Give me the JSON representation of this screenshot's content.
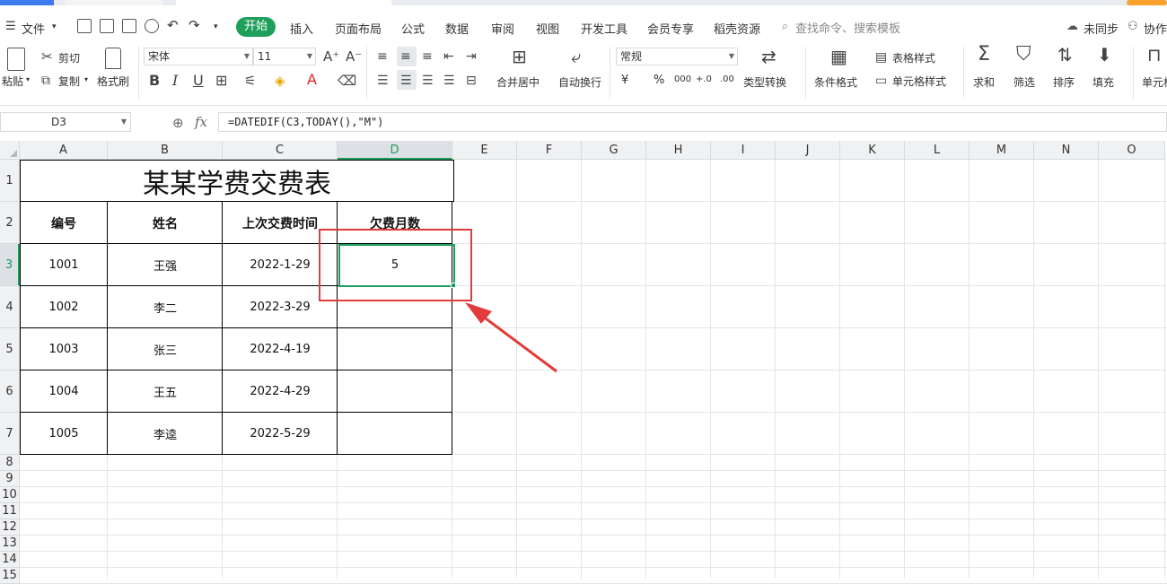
{
  "menubar": {
    "file_label": "文件",
    "start_label": "开始",
    "tabs": [
      "插入",
      "页面布局",
      "公式",
      "数据",
      "审阅",
      "视图",
      "开发工具",
      "会员专享",
      "稻壳资源"
    ],
    "search_placeholder": "查找命令、搜索模板",
    "sync_label": "未同步",
    "collab_label": "协作"
  },
  "ribbon": {
    "paste_label": "粘贴",
    "cut_label": "剪切",
    "copy_label": "复制",
    "format_painter_label": "格式刷",
    "font_name": "宋体",
    "font_size": "11",
    "merge_center_label": "合并居中",
    "wrap_text_label": "自动换行",
    "number_format": "常规",
    "type_convert_label": "类型转换",
    "cond_format_label": "条件格式",
    "table_style_label": "表格样式",
    "cell_style_label": "单元格样式",
    "sum_label": "求和",
    "filter_label": "筛选",
    "sort_label": "排序",
    "fill_label": "填充",
    "cell_label": "单元格",
    "currency_symbol": "¥",
    "percent_symbol": "%",
    "thousands_symbol": "000",
    "dec_inc_symbol": "+.0",
    "dec_dec_symbol": ".00"
  },
  "formula_bar": {
    "name_box": "D3",
    "fx_label": "fx",
    "formula": "=DATEDIF(C3,TODAY(),\"M\")"
  },
  "sheet": {
    "columns": [
      "A",
      "B",
      "C",
      "D",
      "E",
      "F",
      "G",
      "H",
      "I",
      "J",
      "K",
      "L",
      "M",
      "N",
      "O"
    ],
    "rows": [
      "1",
      "2",
      "3",
      "4",
      "5",
      "6",
      "7",
      "8",
      "9",
      "10",
      "11",
      "12",
      "13",
      "14",
      "15"
    ],
    "title": "某某学费交费表",
    "headers": [
      "编号",
      "姓名",
      "上次交费时间",
      "欠费月数"
    ],
    "records": [
      {
        "id": "1001",
        "name": "王强",
        "date": "2022-1-29",
        "months": "5"
      },
      {
        "id": "1002",
        "name": "李二",
        "date": "2022-3-29",
        "months": ""
      },
      {
        "id": "1003",
        "name": "张三",
        "date": "2022-4-19",
        "months": ""
      },
      {
        "id": "1004",
        "name": "王五",
        "date": "2022-4-29",
        "months": ""
      },
      {
        "id": "1005",
        "name": "李逵",
        "date": "2022-5-29",
        "months": ""
      }
    ]
  },
  "colors": {
    "accent_green": "#1e9d5c",
    "annotation_red": "#e23b3b"
  }
}
